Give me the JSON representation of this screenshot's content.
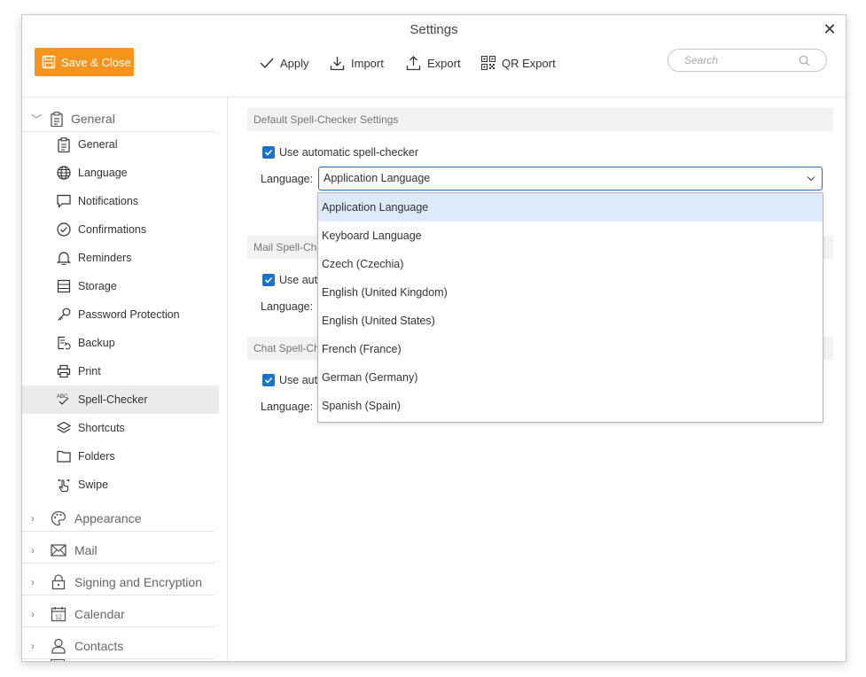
{
  "window": {
    "title": "Settings"
  },
  "toolbar": {
    "save_close": "Save & Close",
    "apply": "Apply",
    "import": "Import",
    "export": "Export",
    "qr_export": "QR Export",
    "search_placeholder": "Search"
  },
  "sidebar": {
    "general_group": "General",
    "items": [
      {
        "label": "General",
        "icon": "clipboard-icon"
      },
      {
        "label": "Language",
        "icon": "globe-icon"
      },
      {
        "label": "Notifications",
        "icon": "chat-bubble-icon"
      },
      {
        "label": "Confirmations",
        "icon": "check-circle-icon"
      },
      {
        "label": "Reminders",
        "icon": "bell-icon"
      },
      {
        "label": "Storage",
        "icon": "storage-icon"
      },
      {
        "label": "Password Protection",
        "icon": "key-icon"
      },
      {
        "label": "Backup",
        "icon": "backup-icon"
      },
      {
        "label": "Print",
        "icon": "printer-icon"
      },
      {
        "label": "Spell-Checker",
        "icon": "spell-check-icon",
        "active": true
      },
      {
        "label": "Shortcuts",
        "icon": "layers-icon"
      },
      {
        "label": "Folders",
        "icon": "folder-icon"
      },
      {
        "label": "Swipe",
        "icon": "swipe-hand-icon"
      }
    ],
    "groups": [
      {
        "label": "Appearance",
        "icon": "palette-icon"
      },
      {
        "label": "Mail",
        "icon": "mail-icon"
      },
      {
        "label": "Signing and Encryption",
        "icon": "lock-icon"
      },
      {
        "label": "Calendar",
        "icon": "calendar-icon"
      },
      {
        "label": "Contacts",
        "icon": "person-icon"
      }
    ]
  },
  "content": {
    "default_section": "Default Spell-Checker Settings",
    "mail_section": "Mail Spell-Che",
    "chat_section": "Chat Spell-Che",
    "use_auto": "Use automatic spell-checker",
    "use_auto_cut": "Use autc",
    "language_label": "Language:",
    "selected_language": "Application Language",
    "options": [
      "Application Language",
      "Keyboard Language",
      "Czech (Czechia)",
      "English (United Kingdom)",
      "English (United States)",
      "French (France)",
      "German (Germany)",
      "Spanish (Spain)"
    ]
  },
  "colors": {
    "accent": "#f7941d",
    "checkbox": "#1a73c9",
    "selected_option": "#dbe9f8"
  }
}
